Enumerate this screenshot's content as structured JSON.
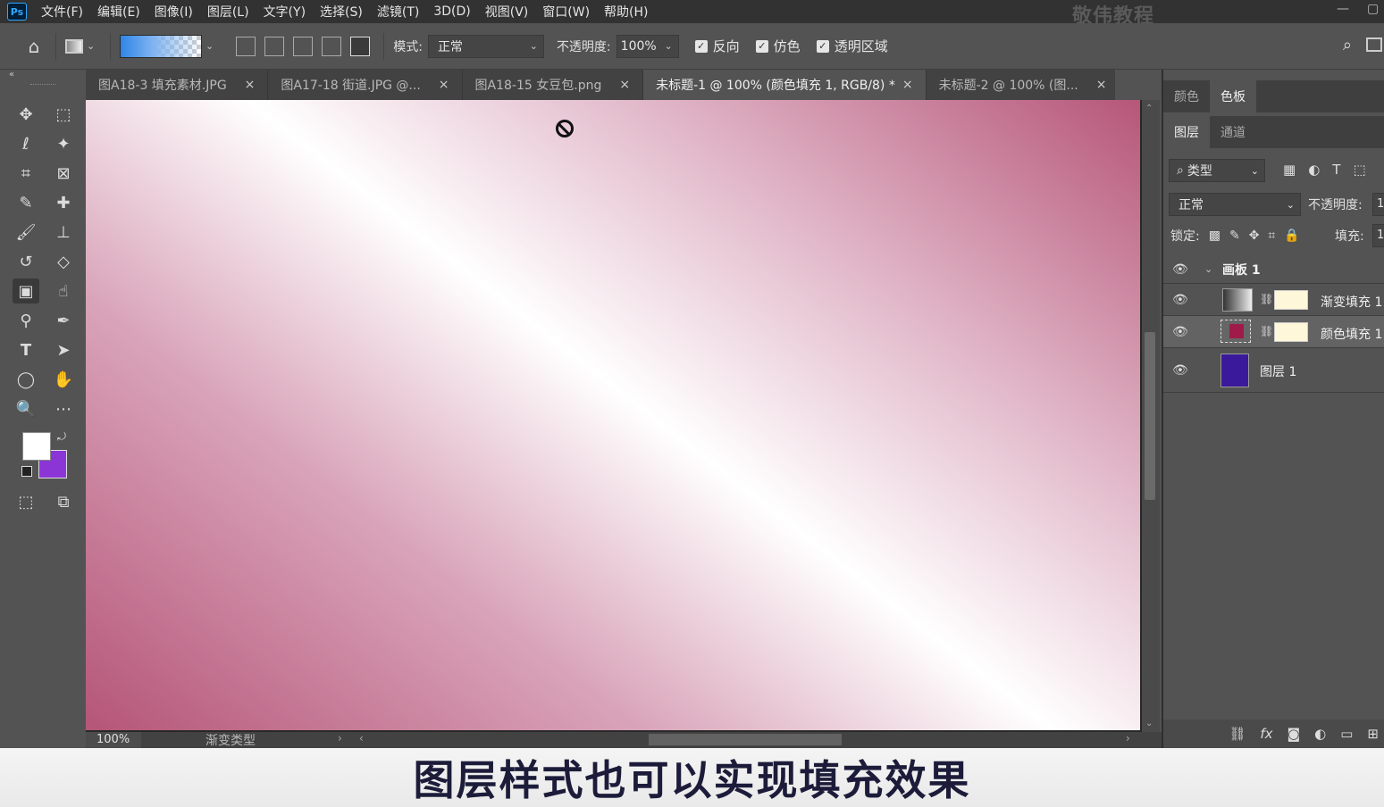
{
  "app": {
    "logo": "Ps",
    "watermark": "敬伟教程",
    "menu": [
      "文件(F)",
      "编辑(E)",
      "图像(I)",
      "图层(L)",
      "文字(Y)",
      "选择(S)",
      "滤镜(T)",
      "3D(D)",
      "视图(V)",
      "窗口(W)",
      "帮助(H)"
    ]
  },
  "options": {
    "mode_label": "模式:",
    "mode_value": "正常",
    "opacity_label": "不透明度:",
    "opacity_value": "100%",
    "reverse_label": "反向",
    "dither_label": "仿色",
    "transparency_label": "透明区域"
  },
  "tabs": [
    {
      "label": "图A18-3 填充素材.JPG"
    },
    {
      "label": "图A17-18 街道.JPG @..."
    },
    {
      "label": "图A18-15 女豆包.png"
    },
    {
      "label": "未标题-1 @ 100% (颜色填充 1, RGB/8) *",
      "active": true
    },
    {
      "label": "未标题-2 @ 100% (图..."
    }
  ],
  "status": {
    "zoom": "100%",
    "info": "渐变类型"
  },
  "colors": {
    "foreground": "#ffffff",
    "background": "#8b35d6"
  },
  "panels": {
    "top_tabs": [
      "颜色",
      "色板"
    ],
    "layer_tabs": [
      "图层",
      "通道"
    ],
    "filter_value": "类型",
    "blend_value": "正常",
    "opacity_label": "不透明度:",
    "opacity_value": "1",
    "lock_label": "锁定:",
    "fill_label": "填充:",
    "fill_value": "1"
  },
  "layers": {
    "group": "画板 1",
    "items": [
      {
        "name": "渐变填充 1",
        "thumb_color": "#777777"
      },
      {
        "name": "颜色填充 1",
        "thumb_color": "#a01a4a",
        "selected": true
      },
      {
        "name": "图层 1",
        "thumb_color": "#3a1a9a"
      }
    ]
  },
  "caption": "图层样式也可以实现填充效果"
}
